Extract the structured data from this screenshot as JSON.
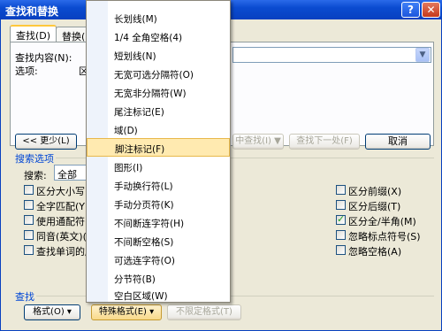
{
  "window": {
    "title": "查找和替换",
    "help_glyph": "?",
    "close_glyph": "✕"
  },
  "tabs": [
    {
      "label": "查找(D)"
    },
    {
      "label": "替换(P)"
    }
  ],
  "find": {
    "label": "查找内容(N):",
    "value": "",
    "options_label": "选项:",
    "options_value": "区"
  },
  "buttons": {
    "less": "<< 更少(L)",
    "replace_truncated": "中查找(I) ▼",
    "find_next": "查找下一处(F)",
    "cancel": "取消",
    "format": "格式(O) ▾",
    "special": "特殊格式(E) ▾",
    "no_format": "不限定格式(T)"
  },
  "search_options": {
    "title": "搜索选项",
    "search_label": "搜索:",
    "search_value": "全部",
    "left_checks": [
      {
        "label": "区分大小写(",
        "checked": false
      },
      {
        "label": "全字匹配(Y)",
        "checked": false
      },
      {
        "label": "使用通配符(",
        "checked": false
      },
      {
        "label": "同音(英文)(",
        "checked": false
      },
      {
        "label": "查找单词的所",
        "checked": false
      }
    ],
    "right_checks": [
      {
        "label": "区分前缀(X)",
        "checked": false
      },
      {
        "label": "区分后缀(T)",
        "checked": false
      },
      {
        "label": "区分全/半角(M)",
        "checked": true
      },
      {
        "label": "忽略标点符号(S)",
        "checked": false
      },
      {
        "label": "忽略空格(A)",
        "checked": false
      }
    ]
  },
  "find_section": {
    "title": "查找"
  },
  "menu": {
    "items": [
      {
        "label": "长划线(M)",
        "highlighted": false
      },
      {
        "label": "1/4 全角空格(4)",
        "highlighted": false
      },
      {
        "label": "短划线(N)",
        "highlighted": false
      },
      {
        "label": "无宽可选分隔符(O)",
        "highlighted": false
      },
      {
        "label": "无宽非分隔符(W)",
        "highlighted": false
      },
      {
        "label": "尾注标记(E)",
        "highlighted": false
      },
      {
        "label": "域(D)",
        "highlighted": false
      },
      {
        "label": "脚注标记(F)",
        "highlighted": true
      },
      {
        "label": "图形(I)",
        "highlighted": false
      },
      {
        "label": "手动换行符(L)",
        "highlighted": false
      },
      {
        "label": "手动分页符(K)",
        "highlighted": false
      },
      {
        "label": "不间断连字符(H)",
        "highlighted": false
      },
      {
        "label": "不间断空格(S)",
        "highlighted": false
      },
      {
        "label": "可选连字符(O)",
        "highlighted": false
      },
      {
        "label": "分节符(B)",
        "highlighted": false
      },
      {
        "label": "空白区域(W)",
        "highlighted": false
      }
    ]
  },
  "colors": {
    "titlebar": "#0a4bd0",
    "highlight": "#ffeab0",
    "section_title": "#0046d5"
  }
}
